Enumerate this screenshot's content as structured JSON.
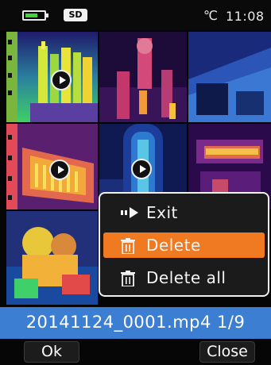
{
  "status_bar": {
    "battery_level": 0.7,
    "storage_badge": "SD",
    "temperature_unit": "℃",
    "time": "11:08"
  },
  "gallery": {
    "selected_index": 0,
    "thumbnails": [
      {
        "name": "thumb-1",
        "is_video": true
      },
      {
        "name": "thumb-2",
        "is_video": false
      },
      {
        "name": "thumb-3",
        "is_video": false
      },
      {
        "name": "thumb-4",
        "is_video": true
      },
      {
        "name": "thumb-5",
        "is_video": true
      },
      {
        "name": "thumb-6",
        "is_video": false
      },
      {
        "name": "thumb-7",
        "is_video": false
      }
    ]
  },
  "context_menu": {
    "items": [
      {
        "label": "Exit",
        "icon": "exit-play-icon",
        "highlighted": false
      },
      {
        "label": "Delete",
        "icon": "trash-icon",
        "highlighted": true
      },
      {
        "label": "Delete all",
        "icon": "trash-icon",
        "highlighted": false
      }
    ]
  },
  "file_info": {
    "text": "20141124_0001.mp4 1/9"
  },
  "softkeys": {
    "left_label": "Ok",
    "right_label": "Close"
  },
  "colors": {
    "accent_blue": "#3c7fd2",
    "highlight_orange": "#f07a22",
    "selection_green": "#22b07c",
    "battery_green": "#44d33c"
  }
}
